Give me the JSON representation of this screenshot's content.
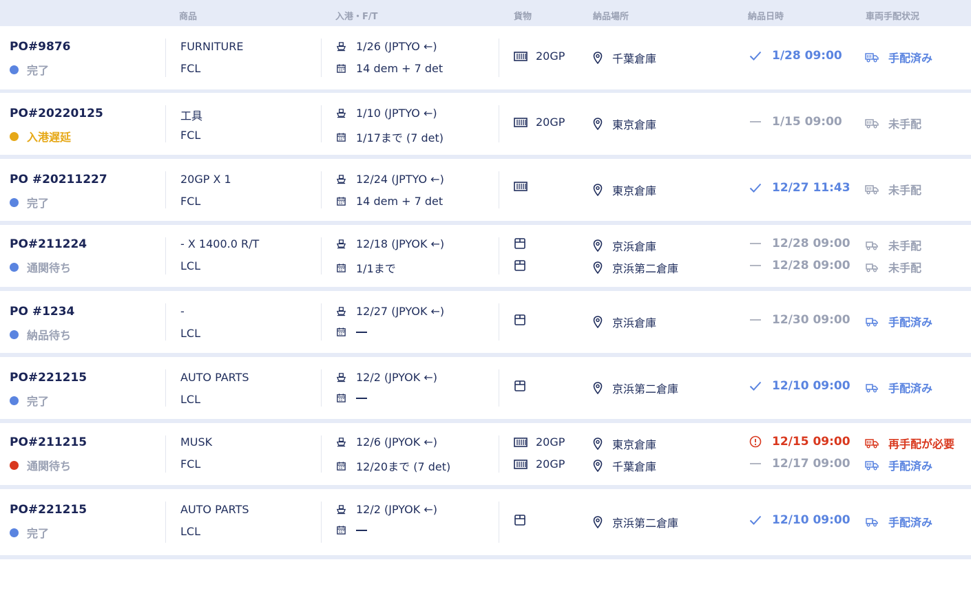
{
  "colors": {
    "header_bg": "#e6ebf7",
    "text_dark": "#1f2d5c",
    "blue": "#5a84e0",
    "gray": "#9aa1b4",
    "yellow": "#e6a817",
    "red": "#d9381e"
  },
  "header": {
    "product": "商品",
    "port": "入港・F/T",
    "cargo": "貨物",
    "place": "納品場所",
    "datetime": "納品日時",
    "arrangement": "車両手配状況"
  },
  "rows": [
    {
      "po": "PO#9876",
      "status": "完了",
      "status_color": "blue",
      "product": "FURNITURE",
      "type": "FCL",
      "port": "1/26 (JPTYO ←)",
      "ft": "14 dem + 7 det",
      "entries": [
        {
          "cargo": "20GP",
          "cargo_icon": "container-icon",
          "place": "千葉倉庫",
          "mark": "check",
          "date": "1/28 09:00",
          "arr": "手配済み",
          "arr_state": "done"
        }
      ]
    },
    {
      "po": "PO#20220125",
      "status": "入港遅延",
      "status_color": "yellow",
      "product": "工具",
      "type": "FCL",
      "port": "1/10 (JPTYO ←)",
      "ft": "1/17まで (7 det)",
      "entries": [
        {
          "cargo": "20GP",
          "cargo_icon": "container-icon",
          "place": "東京倉庫",
          "mark": "dash",
          "date": "1/15 09:00",
          "arr": "未手配",
          "arr_state": "none"
        }
      ]
    },
    {
      "po": "PO #20211227",
      "status": "完了",
      "status_color": "blue",
      "product": "20GP X 1",
      "type": "FCL",
      "port": "12/24 (JPTYO ←)",
      "ft": "14 dem + 7 det",
      "entries": [
        {
          "cargo": "",
          "cargo_icon": "container-icon",
          "place": "東京倉庫",
          "mark": "check",
          "date": "12/27 11:43",
          "arr": "未手配",
          "arr_state": "none"
        }
      ]
    },
    {
      "po": "PO#211224",
      "status": "通関待ち",
      "status_color": "blue",
      "product": "- X 1400.0 R/T",
      "type": "LCL",
      "port": "12/18 (JPYOK ←)",
      "ft": "1/1まで",
      "entries": [
        {
          "cargo": "",
          "cargo_icon": "box-icon",
          "place": "京浜倉庫",
          "mark": "dash",
          "date": "12/28 09:00",
          "arr": "未手配",
          "arr_state": "none-lcl"
        },
        {
          "cargo": "",
          "cargo_icon": "box-icon",
          "place": "京浜第二倉庫",
          "mark": "dash",
          "date": "12/28 09:00",
          "arr": "未手配",
          "arr_state": "none-lcl"
        }
      ]
    },
    {
      "po": "PO #1234",
      "status": "納品待ち",
      "status_color": "blue",
      "product": "-",
      "type": "LCL",
      "port": "12/27 (JPYOK ←)",
      "ft": "",
      "entries": [
        {
          "cargo": "",
          "cargo_icon": "box-icon",
          "place": "京浜倉庫",
          "mark": "dash",
          "date": "12/30 09:00",
          "arr": "手配済み",
          "arr_state": "done-lcl"
        }
      ]
    },
    {
      "po": "PO#221215",
      "status": "完了",
      "status_color": "blue",
      "product": "AUTO PARTS",
      "type": "LCL",
      "port": "12/2 (JPYOK ←)",
      "ft": "",
      "entries": [
        {
          "cargo": "",
          "cargo_icon": "box-icon",
          "place": "京浜第二倉庫",
          "mark": "check",
          "date": "12/10 09:00",
          "arr": "手配済み",
          "arr_state": "done-lcl"
        }
      ]
    },
    {
      "po": "PO#211215",
      "status": "通関待ち",
      "status_color": "red",
      "product": "MUSK",
      "type": "FCL",
      "port": "12/6 (JPYOK ←)",
      "ft": "12/20まで (7 det)",
      "entries": [
        {
          "cargo": "20GP",
          "cargo_icon": "container-icon",
          "place": "東京倉庫",
          "mark": "info",
          "date": "12/15 09:00",
          "arr": "再手配が必要",
          "arr_state": "alert"
        },
        {
          "cargo": "20GP",
          "cargo_icon": "container-icon",
          "place": "千葉倉庫",
          "mark": "dash",
          "date": "12/17 09:00",
          "arr": "手配済み",
          "arr_state": "done"
        }
      ]
    },
    {
      "po": "PO#221215",
      "status": "完了",
      "status_color": "blue",
      "product": "AUTO PARTS",
      "type": "LCL",
      "port": "12/2 (JPYOK ←)",
      "ft": "",
      "entries": [
        {
          "cargo": "",
          "cargo_icon": "box-icon",
          "place": "京浜第二倉庫",
          "mark": "check",
          "date": "12/10 09:00",
          "arr": "手配済み",
          "arr_state": "done-lcl"
        }
      ]
    }
  ]
}
